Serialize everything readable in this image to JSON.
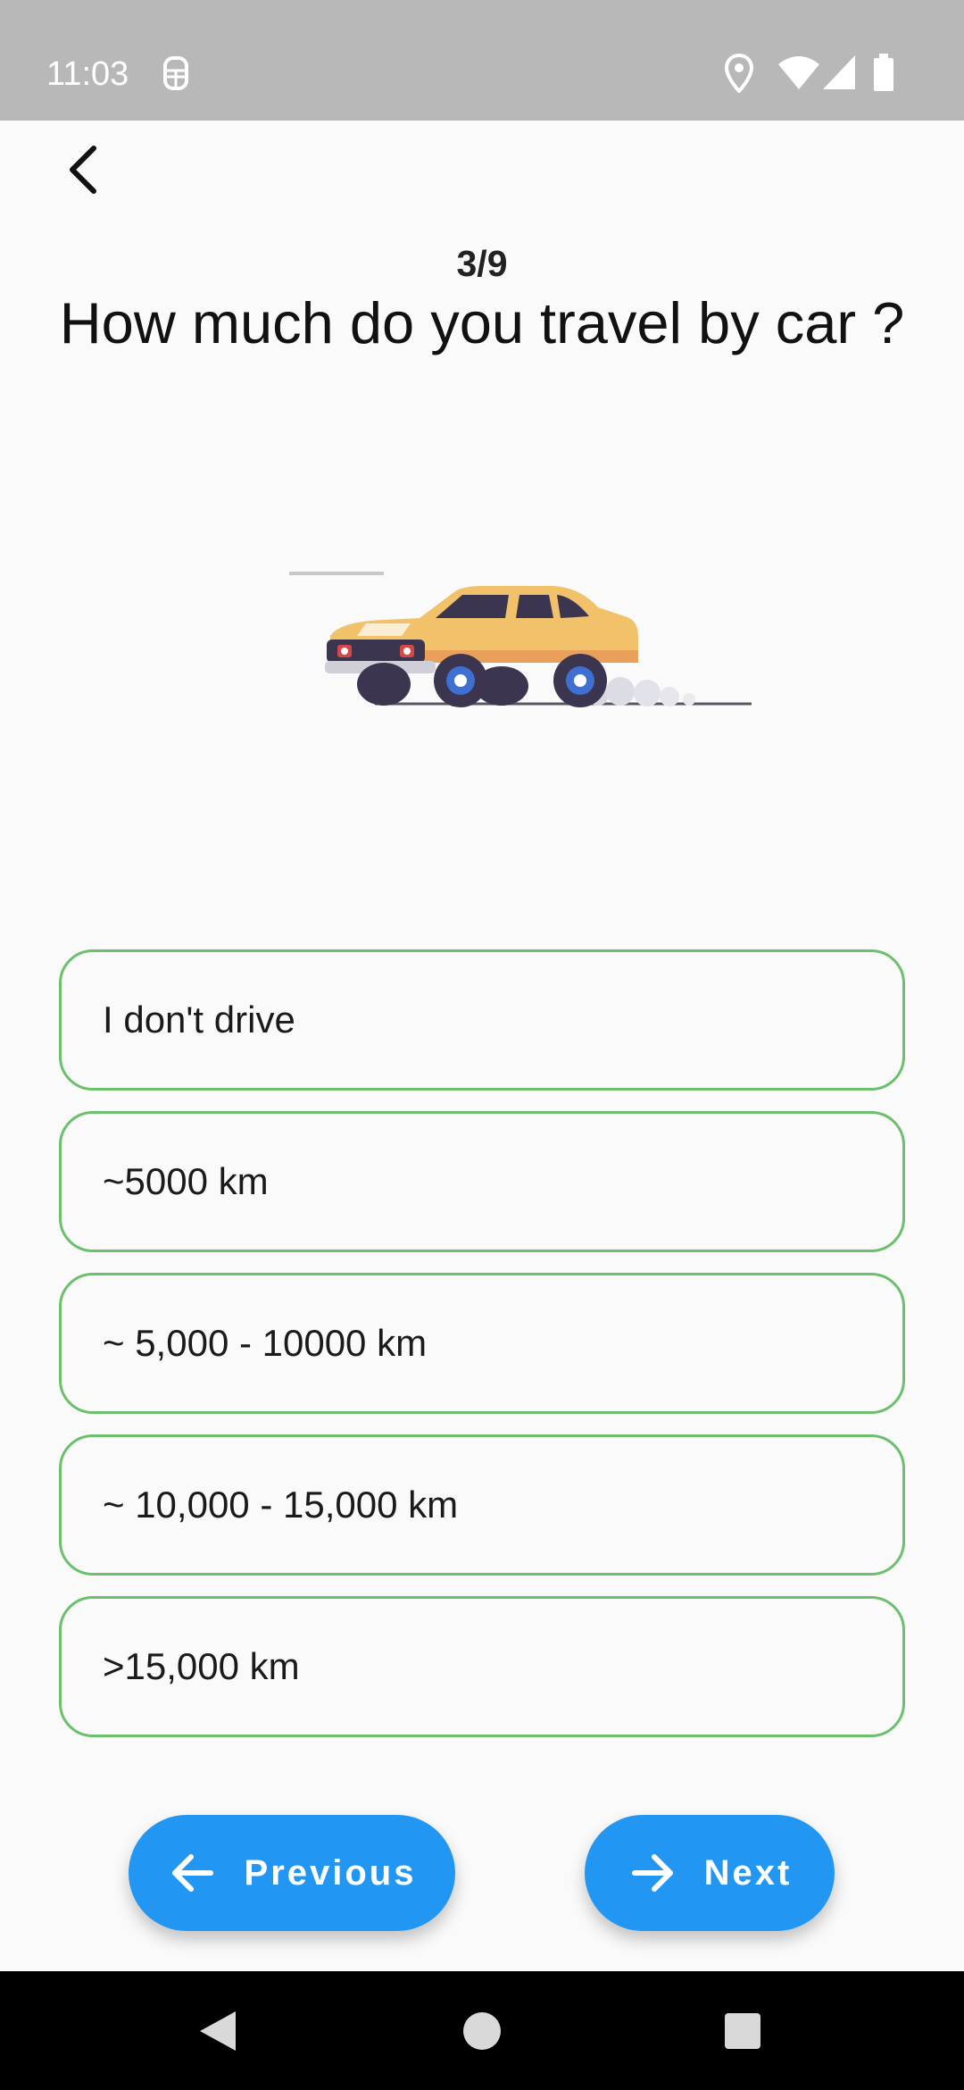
{
  "status_bar": {
    "time": "11:03",
    "left_icon": "sim-card-icon",
    "right_icons": [
      "location-icon",
      "wifi-icon",
      "signal-icon",
      "battery-icon"
    ]
  },
  "header": {
    "back_icon": "chevron-left-icon"
  },
  "quiz": {
    "progress": "3/9",
    "question": "How much do you travel by car ?"
  },
  "options": [
    {
      "label": "I don't drive"
    },
    {
      "label": "~5000 km"
    },
    {
      "label": "~ 5,000 - 10000 km"
    },
    {
      "label": "~ 10,000 - 15,000 km"
    },
    {
      "label": ">15,000 km"
    }
  ],
  "footer": {
    "previous_label": "Previous",
    "previous_icon": "arrow-left-icon",
    "next_label": "Next",
    "next_icon": "arrow-right-icon"
  },
  "colors": {
    "status_bar": "#b8b8b8",
    "background": "#fafafa",
    "option_border": "#6cbf6c",
    "button": "#2196f3",
    "button_text": "#ffffff",
    "car_body": "#f2c26b",
    "system_nav": "#000000"
  },
  "system_nav": {
    "buttons": [
      "back-triangle-icon",
      "home-circle-icon",
      "recents-square-icon"
    ]
  }
}
